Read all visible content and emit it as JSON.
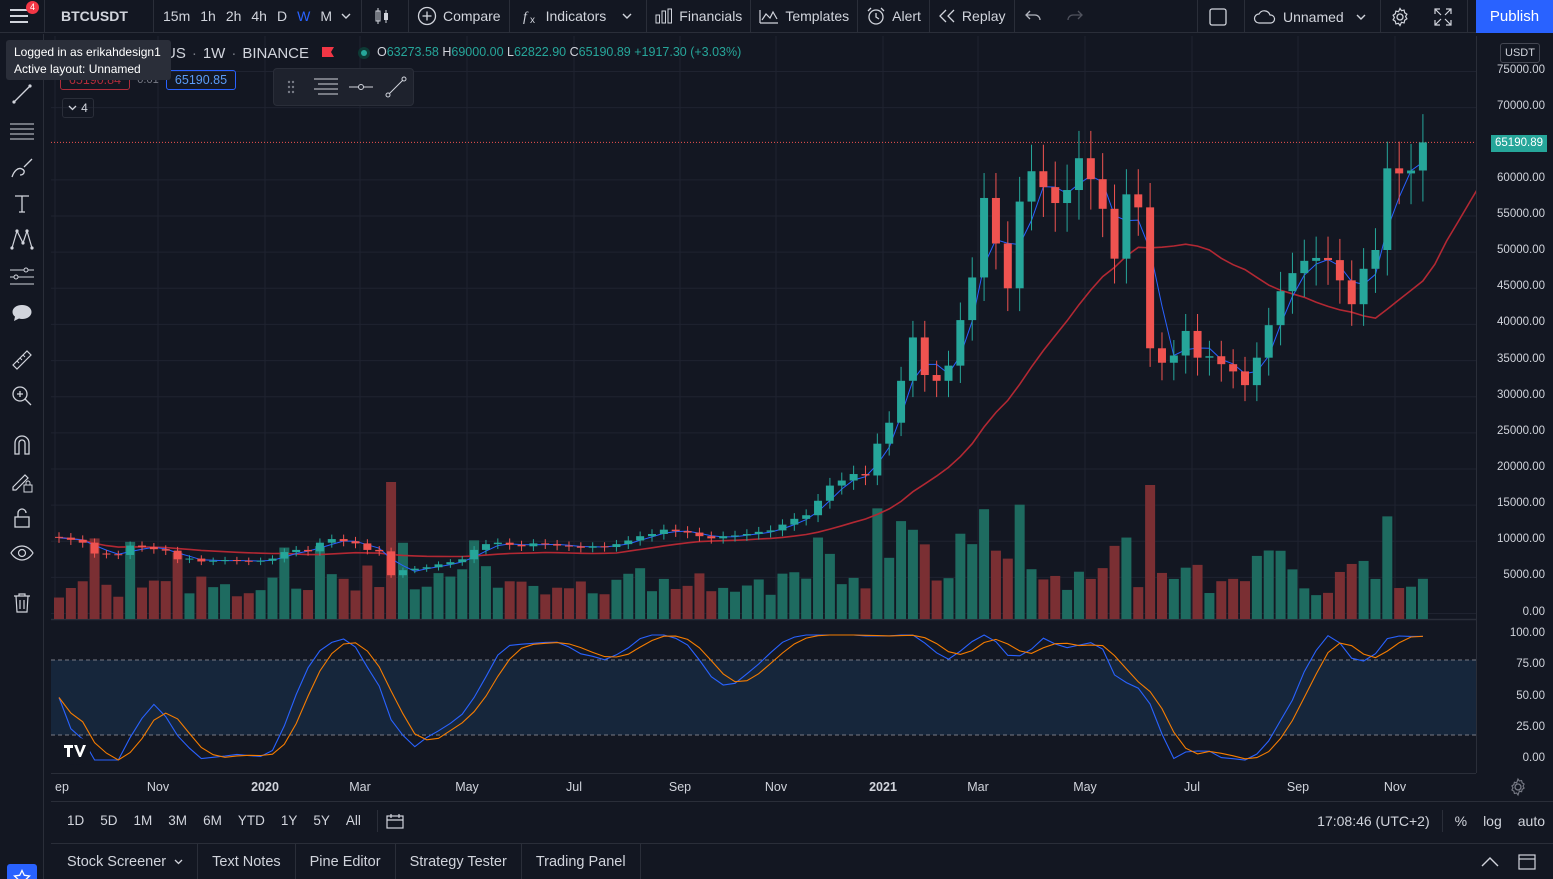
{
  "topbar": {
    "menu_badge": "4",
    "symbol": "BTCUSDT",
    "intervals": [
      "15m",
      "1h",
      "2h",
      "4h",
      "D",
      "W",
      "M"
    ],
    "active_interval": "W",
    "compare_label": "Compare",
    "indicators_label": "Indicators",
    "financials_label": "Financials",
    "templates_label": "Templates",
    "alert_label": "Alert",
    "replay_label": "Replay",
    "layout_name": "Unnamed",
    "publish_label": "Publish"
  },
  "tooltip": {
    "line1": "Logged in as erikahdesign1",
    "line2": "Active layout: Unnamed"
  },
  "legend": {
    "title_fragment": "rUS",
    "interval": "1W",
    "exchange": "BINANCE",
    "o_key": "O",
    "o": "63273.58",
    "h_key": "H",
    "h": "69000.00",
    "l_key": "L",
    "l": "62822.90",
    "c_key": "C",
    "c": "65190.89",
    "change": "+1917.30 (+3.03%)",
    "sell_price": "65190.84",
    "spread": "0.01",
    "buy_price": "65190.85",
    "indicator_count": "4"
  },
  "price_axis": {
    "currency": "USDT",
    "current_price": "65190.89",
    "labels": [
      "75000.00",
      "70000.00",
      "60000.00",
      "55000.00",
      "50000.00",
      "45000.00",
      "40000.00",
      "35000.00",
      "30000.00",
      "25000.00",
      "20000.00",
      "15000.00",
      "10000.00",
      "5000.00",
      "0.00"
    ],
    "osc_labels": [
      "100.00",
      "75.00",
      "50.00",
      "25.00",
      "0.00"
    ]
  },
  "time_axis": {
    "labels": [
      "ep",
      "Nov",
      "2020",
      "Mar",
      "May",
      "Jul",
      "Sep",
      "Nov",
      "2021",
      "Mar",
      "May",
      "Jul",
      "Sep",
      "Nov"
    ]
  },
  "range_bar": {
    "ranges": [
      "1D",
      "5D",
      "1M",
      "3M",
      "6M",
      "YTD",
      "1Y",
      "5Y",
      "All"
    ],
    "time": "17:08:46 (UTC+2)",
    "percent": "%",
    "log": "log",
    "auto": "auto"
  },
  "bottom_bar": {
    "tabs": [
      "Stock Screener",
      "Text Notes",
      "Pine Editor",
      "Strategy Tester",
      "Trading Panel"
    ]
  },
  "colors": {
    "up": "#26a69a",
    "down": "#ef5350",
    "accent": "#2962ff",
    "ma_line": "#b22833",
    "fast_ma": "#2962ff",
    "stoch_k": "#2962ff",
    "stoch_d": "#f57c00"
  },
  "chart_data": {
    "type": "candlestick",
    "symbol": "BTCUSDT",
    "interval": "1W",
    "ylim": [
      0,
      75000
    ],
    "closes": [
      10500,
      10200,
      9800,
      8300,
      8200,
      8100,
      9400,
      9200,
      8900,
      8700,
      7500,
      7600,
      7200,
      7300,
      7400,
      7300,
      7200,
      7300,
      7600,
      8500,
      8800,
      8600,
      9800,
      10300,
      10000,
      9700,
      8800,
      8600,
      5300,
      6000,
      6200,
      6400,
      6800,
      7100,
      7500,
      8800,
      9600,
      9800,
      9500,
      9300,
      9700,
      9600,
      9400,
      9300,
      9100,
      9300,
      9200,
      9600,
      10100,
      10700,
      11000,
      11600,
      11400,
      11200,
      10700,
      10400,
      10700,
      10800,
      11000,
      11300,
      11500,
      12300,
      13100,
      13600,
      15600,
      17700,
      18400,
      19300,
      19100,
      23500,
      26400,
      32200,
      38200,
      33000,
      32200,
      34300,
      40600,
      46500,
      57500,
      51200,
      45000,
      57000,
      61200,
      59000,
      56800,
      58600,
      63000,
      60100,
      56000,
      49100,
      58000,
      56200,
      36700,
      34700,
      35700,
      39100,
      35400,
      35600,
      34500,
      33500,
      31600,
      35400,
      39900,
      44600,
      47100,
      48800,
      49200,
      48900,
      46100,
      42800,
      47700,
      50300,
      61600,
      60900,
      61300,
      65190
    ],
    "fast_ma_desc": "short moving average following price",
    "slow_ma_desc": "long moving average"
  }
}
